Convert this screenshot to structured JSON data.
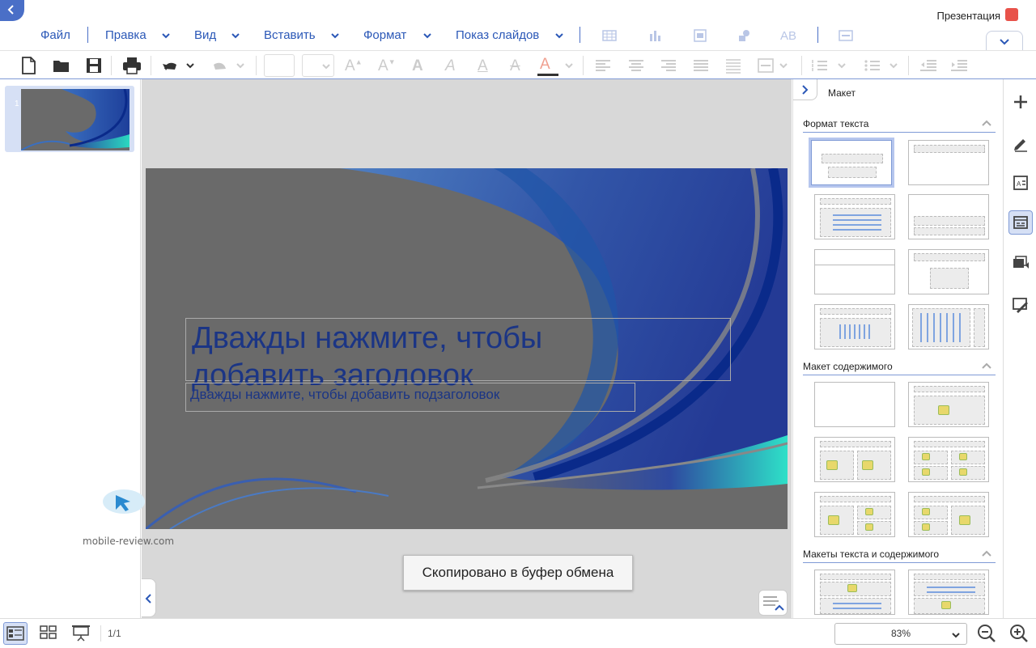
{
  "app": {
    "title": "Презентация"
  },
  "menu": {
    "items": [
      {
        "label": "Файл"
      },
      {
        "label": "Правка"
      },
      {
        "label": "Вид"
      },
      {
        "label": "Вставить"
      },
      {
        "label": "Формат"
      },
      {
        "label": "Показ слайдов"
      }
    ]
  },
  "slide": {
    "title_placeholder": "Дважды нажмите, чтобы добавить заголовок",
    "subtitle_placeholder": "Дважды нажмите, чтобы добавить подзаголовок",
    "thumbnail_number": "1"
  },
  "toast": {
    "message": "Скопировано в буфер обмена"
  },
  "watermark": {
    "text": "mobile-review.com"
  },
  "side_panel": {
    "title": "Макет",
    "sections": [
      {
        "label": "Формат текста"
      },
      {
        "label": "Макет содержимого"
      },
      {
        "label": "Макеты текста и содержимого"
      }
    ]
  },
  "status": {
    "page": "1/1",
    "zoom": "83%"
  },
  "colors": {
    "accent": "#2b58b7",
    "selection": "#d6e0f5",
    "toast_bg": "#f5f5f5"
  }
}
